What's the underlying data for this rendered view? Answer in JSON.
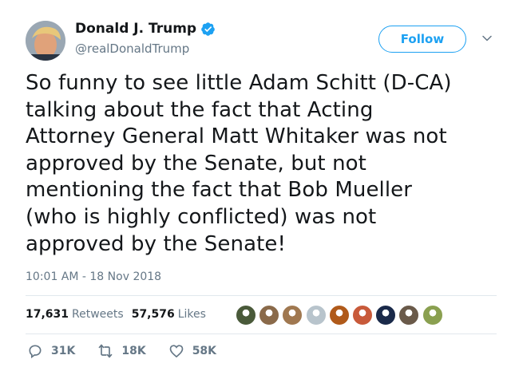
{
  "user": {
    "display_name": "Donald J. Trump",
    "handle": "@realDonaldTrump",
    "verified": true
  },
  "header": {
    "follow_label": "Follow"
  },
  "tweet": {
    "lines": [
      "So funny to see little Adam Schitt (D-CA)",
      "talking about the fact that Acting",
      "Attorney General Matt Whitaker was not",
      "approved by the Senate, but not",
      "mentioning the fact that Bob Mueller",
      "(who is highly conflicted) was not",
      "approved by the Senate!"
    ],
    "timestamp": "10:01 AM - 18 Nov 2018"
  },
  "stats": {
    "retweets_count": "17,631",
    "retweets_label": "Retweets",
    "likes_count": "57,576",
    "likes_label": "Likes"
  },
  "liker_avatars": [
    "#4a5a3a",
    "#8a6a4a",
    "#a07850",
    "#b8c4cc",
    "#b05a1a",
    "#c85a3a",
    "#1a2a4a",
    "#6a5a4a",
    "#8aa050"
  ],
  "actions": {
    "replies": "31K",
    "retweets": "18K",
    "likes": "58K"
  },
  "colors": {
    "accent": "#1da1f2",
    "muted": "#657786"
  }
}
